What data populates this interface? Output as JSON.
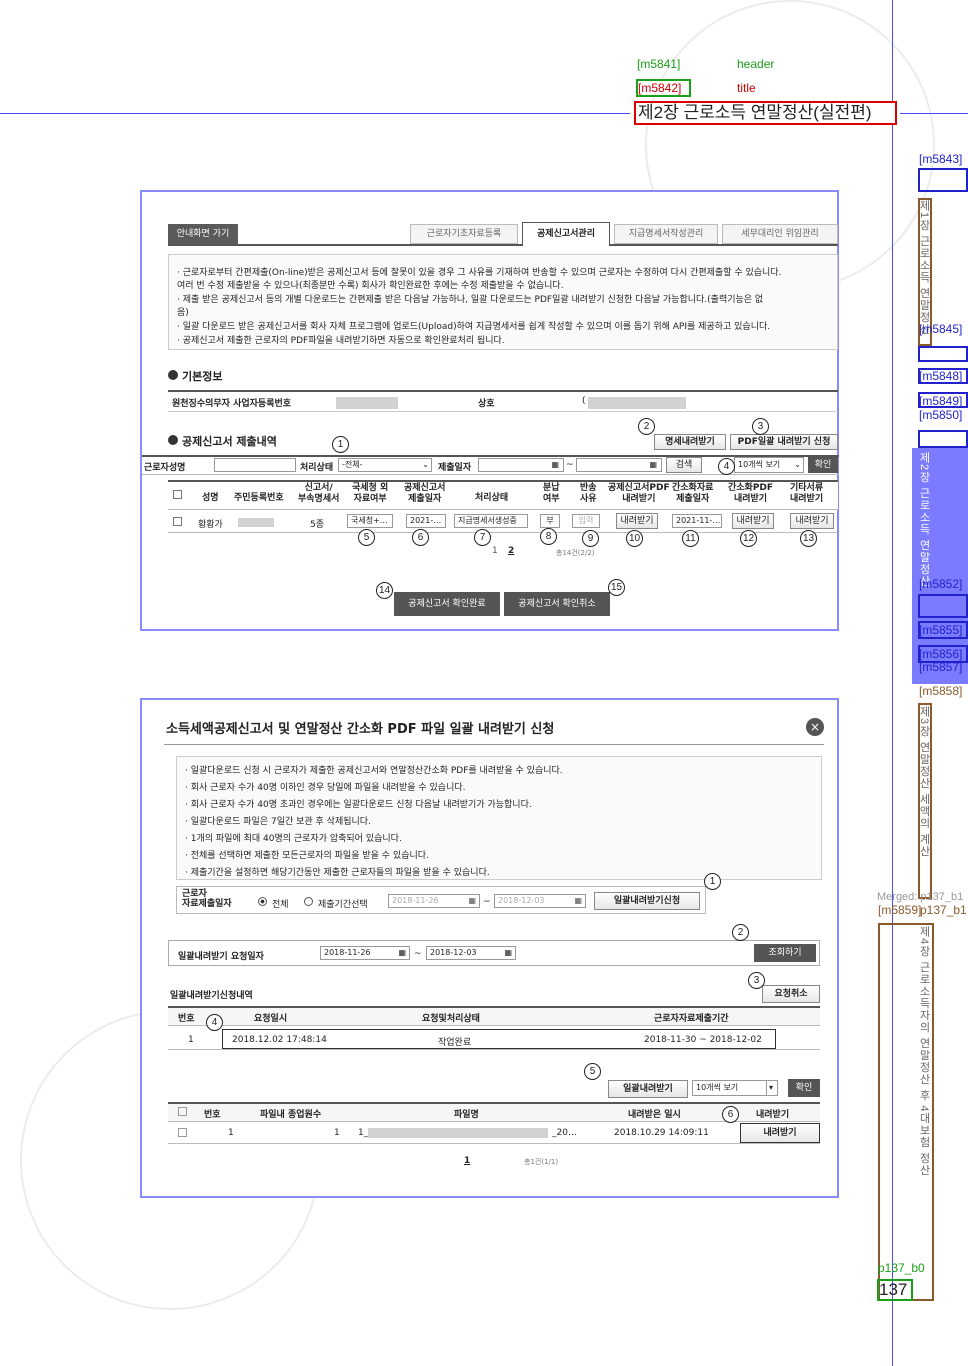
{
  "annotations": {
    "m5841": "[m5841]",
    "header": "header",
    "m5842": "[m5842]",
    "title_tag": "title",
    "m5843": "[m5843]",
    "m5845": "[m5845]",
    "m5848": "[m5848]",
    "m5849": "[m5849]",
    "m5850": "[m5850]",
    "m5852": "[m5852]",
    "m5855": "[m5855]",
    "m5856": "[m5856]",
    "m5857": "[m5857]",
    "m5858": "[m5858]",
    "merged": "Merged: p137_b1",
    "m5859": "[m5859]",
    "p137": "p137_b1",
    "p137_b0": "p137_b0"
  },
  "header_title": "제2장 근로소득 연말정산(실전편)",
  "page_number": "137",
  "sidebar_items": [
    "제1장 근로소득 연말정산 개요",
    "제2장 근로소득 연말정산 실무",
    "제3장 연말정산 세액의 계산",
    "제4장 근로소득자의 연말정산 후 4대보험 정산"
  ],
  "fig1": {
    "home_button": "안내화면 가기",
    "tabs": [
      "근로자기초자료등록",
      "공제신고서관리",
      "지급명세서작성관리",
      "세무대리인 위임관리"
    ],
    "notes": [
      "· 근로자로부터 간편제출(On-line)받은 공제신고서 등에 잘못이 있을 경우 그 사유를 기재하여 반송할 수 있으며 근로자는 수정하여 다시 간편제출할 수 있습니다.",
      "  여러 번 수정 제출받을 수 있으나(최종분만 수록) 회사가 확인완료한 후에는 수정 제출받을 수 없습니다.",
      "· 제출 받은 공제신고서 등의 개별 다운로드는 간편제출 받은 다음날 가능하나, 일괄 다운로드는 PDF일괄 내려받기 신청한 다음날 가능합니다.(출력기능은 없",
      "  음)",
      "· 일괄 다운로드 받은 공제신고서를 회사 자체 프로그램에 업로드(Upload)하여 지급명세서를 쉽게 작성할 수 있으며 이를 돕기 위해 API를 제공하고 있습니다.",
      "· 공제신고서 제출한 근로자의 PDF파일을 내려받기하면 자동으로 확인완료처리 됩니다."
    ],
    "basic_info_title": "기본정보",
    "biz_no_label": "원천징수의무자 사업자등록번호",
    "company_label": "상호",
    "company_prefix": "(",
    "submission_title": "공제신고서 제출내역",
    "detail_download_btn": "명세내려받기",
    "pdf_bulk_btn": "PDF일괄 내려받기 신청",
    "worker_name_label": "근로자성명",
    "status_label": "처리상태",
    "status_value": "-전체-",
    "submit_date_label": "제출일자",
    "date_sep": "~",
    "search_btn": "검색",
    "view_count": "10개씩 보기",
    "confirm_btn": "확인",
    "columns": [
      "성명",
      "주민등록번호",
      "신고서/\n부속명세서",
      "국세청 외\n자료여부",
      "공제신고서\n제출일자",
      "처리상태",
      "분납\n여부",
      "반송\n사유",
      "공제신고서PDF\n내려받기",
      "간소화자료\n제출일자",
      "간소화PDF\n내려받기",
      "기타서류\n내려받기"
    ],
    "row": {
      "name": "황황가",
      "count": "5종",
      "nts": "국세청+…",
      "date": "2021-…",
      "status": "지급명세서생성중",
      "split": "부",
      "reason": "입력",
      "pdf_dl": "내려받기",
      "simple_date": "2021-11-…",
      "simple_dl": "내려받기",
      "etc_dl": "내려받기"
    },
    "pages": [
      "1",
      "2"
    ],
    "total": "총14건(2/2)",
    "confirm_complete_btn": "공제신고서 확인완료",
    "confirm_cancel_btn": "공제신고서 확인취소",
    "markers": [
      "1",
      "2",
      "3",
      "4",
      "5",
      "6",
      "7",
      "8",
      "9",
      "10",
      "11",
      "12",
      "13",
      "14",
      "15"
    ]
  },
  "fig2": {
    "title": "소득세액공제신고서 및 연말정산 간소화 PDF 파일 일괄 내려받기 신청",
    "close": "×",
    "notes": [
      "· 일괄다운로드 신청 시 근로자가 제출한 공제신고서와 연말정산간소화 PDF를 내려받을 수 있습니다.",
      "· 회사 근로자 수가 40명 이하인 경우 당일에 파일을 내려받을 수 있습니다.",
      "· 회사 근로자 수가 40명 초과인 경우에는 일괄다운로드 신청 다음날 내려받기가 가능합니다.",
      "· 일괄다운로드 파일은 7일간 보관 후 삭제됩니다.",
      "· 1개의 파일에 최대 40명의 근로자가 압축되어 있습니다.",
      "· 전체를 선택하면 제출한 모든근로자의 파일을 받을 수 있습니다.",
      "· 제출기간을 설정하면 해당기간동안 제출한 근로자들의 파일을 받을 수 있습니다."
    ],
    "submit_label": "근로자\n자료제출일자",
    "radio_all": "전체",
    "radio_period": "제출기간선택",
    "date_from": "2018-11-26",
    "date_to": "2018-12-03",
    "bulk_request_btn": "일괄내려받기신청",
    "request_date_label": "일괄내려받기 요청일자",
    "req_from": "2018-11-26",
    "req_to": "2018-12-03",
    "inquiry_btn": "조회하기",
    "history_title": "일괄내려받기신청내역",
    "cancel_request_btn": "요청취소",
    "hist_cols": [
      "번호",
      "요청일시",
      "요청및처리상태",
      "근로자자료제출기간"
    ],
    "hist_row": {
      "no": "1",
      "datetime": "2018.12.02 17:48:14",
      "status": "작업완료",
      "period": "2018-11-30 ~ 2018-12-02"
    },
    "bulk_download_btn": "일괄내려받기",
    "view_count": "10개씩 보기",
    "confirm_btn": "확인",
    "file_cols": [
      "번호",
      "파일내 종업원수",
      "파일명",
      "내려받은 일시",
      "내려받기"
    ],
    "file_row": {
      "no": "1",
      "count": "1",
      "name_prefix": "1_",
      "name_suffix": "_20…",
      "datetime": "2018.10.29 14:09:11",
      "download": "내려받기"
    },
    "page": "1",
    "total": "총1건(1/1)",
    "markers": [
      "1",
      "2",
      "3",
      "4",
      "5",
      "6"
    ]
  }
}
